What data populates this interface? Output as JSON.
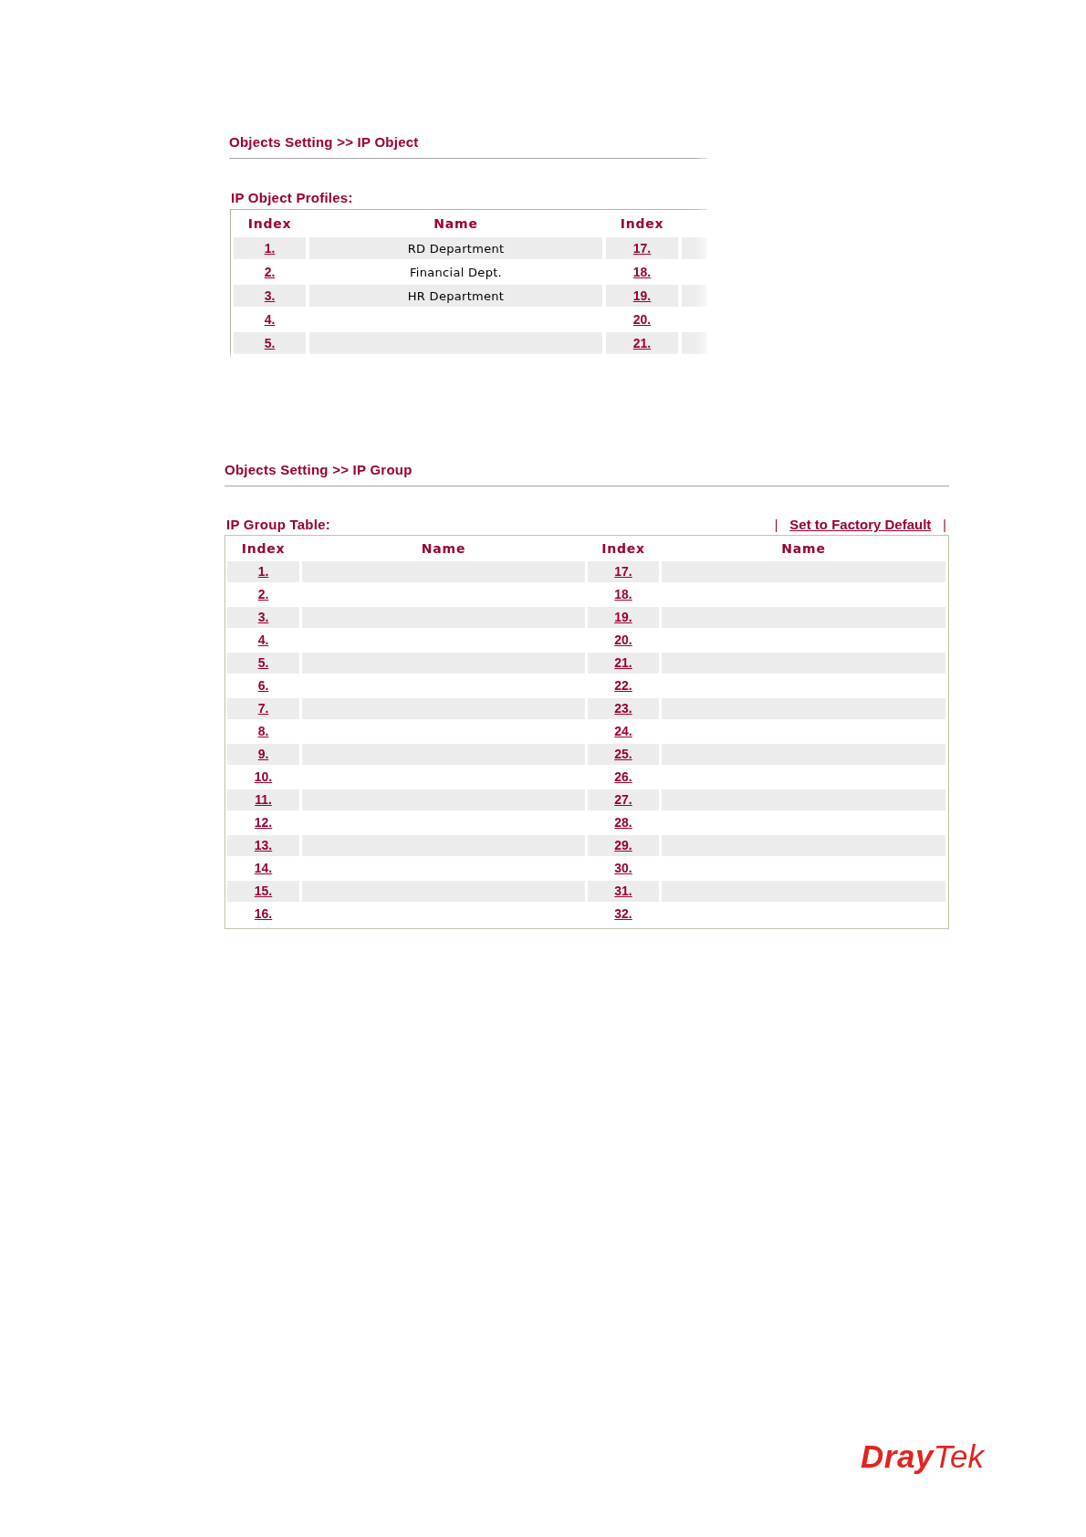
{
  "ip_object": {
    "breadcrumb": "Objects Setting >> IP Object",
    "table_title": "IP Object Profiles:",
    "columns": [
      "Index",
      "Name",
      "Index"
    ],
    "rows": [
      {
        "index": "1.",
        "name": "RD Department",
        "index_2": "17."
      },
      {
        "index": "2.",
        "name": "Financial Dept.",
        "index_2": "18."
      },
      {
        "index": "3.",
        "name": "HR Department",
        "index_2": "19."
      },
      {
        "index": "4.",
        "index_2": "20."
      },
      {
        "index": "5.",
        "index_2": "21."
      }
    ]
  },
  "ip_group": {
    "breadcrumb": "Objects Setting >> IP Group",
    "table_title": "IP Group Table:",
    "toolbar": [
      {
        "kind": "separator",
        "text": "|"
      },
      {
        "kind": "link",
        "text": "Set to Factory Default"
      },
      {
        "kind": "separator",
        "text": "|"
      }
    ],
    "columns": [
      "Index",
      "Name",
      "Index",
      "Name"
    ],
    "rows": [
      {
        "index": "1.",
        "index_2": "17."
      },
      {
        "index": "2.",
        "index_2": "18."
      },
      {
        "index": "3.",
        "index_2": "19."
      },
      {
        "index": "4.",
        "index_2": "20."
      },
      {
        "index": "5.",
        "index_2": "21."
      },
      {
        "index": "6.",
        "index_2": "22."
      },
      {
        "index": "7.",
        "index_2": "23."
      },
      {
        "index": "8.",
        "index_2": "24."
      },
      {
        "index": "9.",
        "index_2": "25."
      },
      {
        "index": "10.",
        "index_2": "26."
      },
      {
        "index": "11.",
        "index_2": "27."
      },
      {
        "index": "12.",
        "index_2": "28."
      },
      {
        "index": "13.",
        "index_2": "29."
      },
      {
        "index": "14.",
        "index_2": "30."
      },
      {
        "index": "15.",
        "index_2": "31."
      },
      {
        "index": "16.",
        "index_2": "32."
      }
    ]
  },
  "logo": {
    "parts": [
      "Dray",
      "Tek"
    ]
  }
}
